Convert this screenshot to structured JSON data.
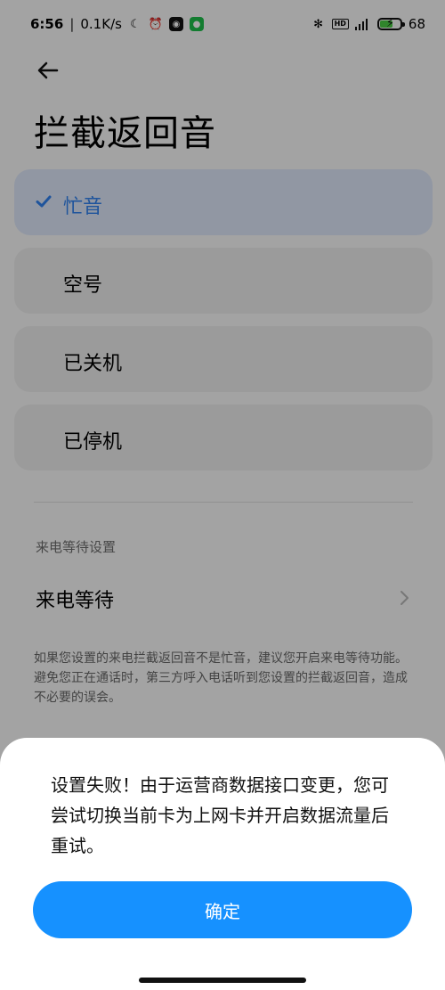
{
  "status_bar": {
    "time": "6:56",
    "separator": "|",
    "speed": "0.1K/s",
    "battery_percent": "68",
    "hd": "HD"
  },
  "header": {
    "title": "拦截返回音"
  },
  "options": [
    {
      "label": "忙音",
      "selected": true
    },
    {
      "label": "空号",
      "selected": false
    },
    {
      "label": "已关机",
      "selected": false
    },
    {
      "label": "已停机",
      "selected": false
    }
  ],
  "section": {
    "label": "来电等待设置"
  },
  "call_waiting": {
    "label": "来电等待"
  },
  "info": {
    "text": "如果您设置的来电拦截返回音不是忙音，建议您开启来电等待功能。避免您正在通话时，第三方呼入电话听到您设置的拦截返回音，造成不必要的误会。"
  },
  "dialog": {
    "message": "设置失败！由于运营商数据接口变更，您可尝试切换当前卡为上网卡并开启数据流量后重试。",
    "confirm_label": "确定"
  },
  "colors": {
    "accent": "#1691ff",
    "selected_bg": "#dce6f7",
    "selected_text": "#2f80ed",
    "overlay": "rgba(0,0,0,0.34)",
    "battery_fill": "#49ca43"
  }
}
